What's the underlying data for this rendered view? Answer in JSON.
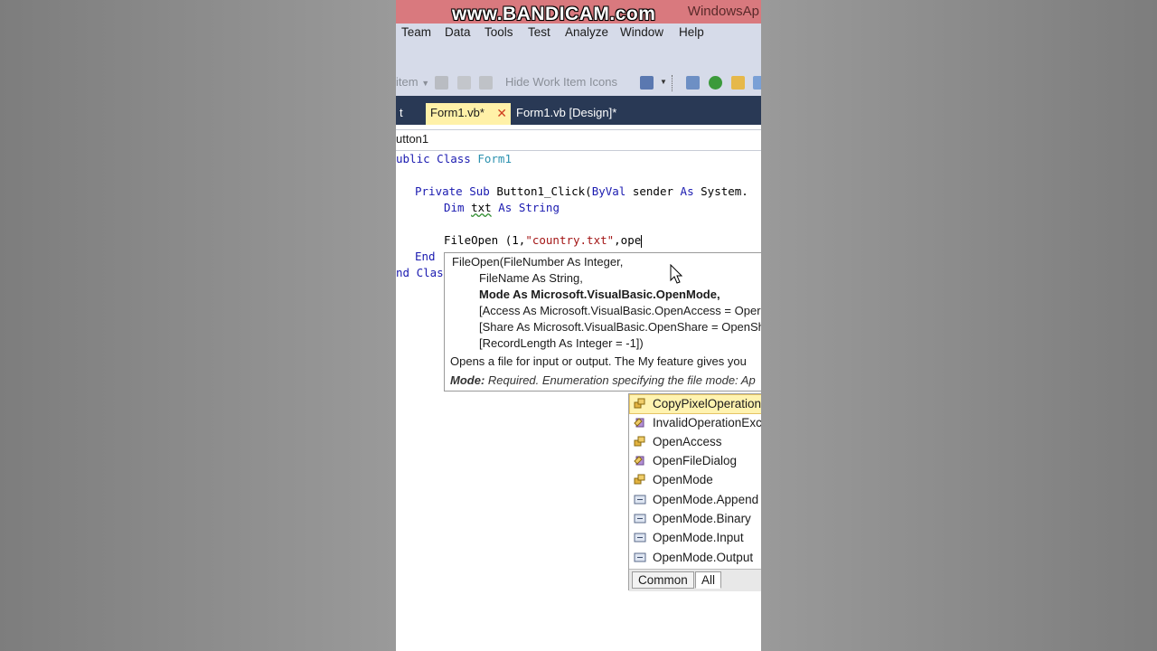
{
  "watermark": "www.BANDICAM.com",
  "window_title": "WindowsAp",
  "menu": [
    "Team",
    "Data",
    "Tools",
    "Test",
    "Analyze",
    "Window",
    "Help"
  ],
  "toolbar": {
    "item_dropdown": "item",
    "hide_work_item_icons": "Hide Work Item Icons"
  },
  "tabs": {
    "previous": "t",
    "active": "Form1.vb*",
    "close": "✕",
    "design": "Form1.vb [Design]*"
  },
  "navbar": {
    "object": "utton1"
  },
  "code": {
    "l1": [
      "ublic",
      "Class",
      "Form1"
    ],
    "l2": [
      "Private",
      "Sub",
      "Button1_Click(",
      "ByVal",
      "sender",
      "As",
      "System."
    ],
    "l3": [
      "Dim",
      "txt",
      "As",
      "String"
    ],
    "l4": [
      "FileOpen (1,",
      "\"country.txt\"",
      ",ope"
    ],
    "l5": [
      "End"
    ],
    "l6": [
      "nd",
      "Clas"
    ]
  },
  "tooltip": {
    "signature": "FileOpen(FileNumber As Integer,",
    "p_filename": "FileName As String,",
    "p_mode": "Mode As Microsoft.VisualBasic.OpenMode,",
    "p_access": "[Access As Microsoft.VisualBasic.OpenAccess = Oper",
    "p_share": "[Share As Microsoft.VisualBasic.OpenShare = OpenSh",
    "p_reclen": "[RecordLength As Integer = -1])",
    "description": "Opens a file for input or output. The My feature gives you",
    "mode_label": "Mode:",
    "mode_text": "Required. Enumeration specifying the file mode: Ap"
  },
  "completion": {
    "items": [
      {
        "label": "CopyPixelOperation",
        "icon": "enum-icon"
      },
      {
        "label": "InvalidOperationExce",
        "icon": "class-icon"
      },
      {
        "label": "OpenAccess",
        "icon": "enum-icon"
      },
      {
        "label": "OpenFileDialog",
        "icon": "class-icon"
      },
      {
        "label": "OpenMode",
        "icon": "enum-icon"
      },
      {
        "label": "OpenMode.Append",
        "icon": "enum-member-icon"
      },
      {
        "label": "OpenMode.Binary",
        "icon": "enum-member-icon"
      },
      {
        "label": "OpenMode.Input",
        "icon": "enum-member-icon"
      },
      {
        "label": "OpenMode.Output",
        "icon": "enum-member-icon"
      }
    ],
    "tab_common": "Common",
    "tab_all": "All"
  },
  "colors": {
    "keyword": "#1a1ab0",
    "type": "#2b91af",
    "string": "#a31515",
    "tab_active": "#fff1a8",
    "tabbar": "#293955",
    "selection": "#fff3b0"
  }
}
